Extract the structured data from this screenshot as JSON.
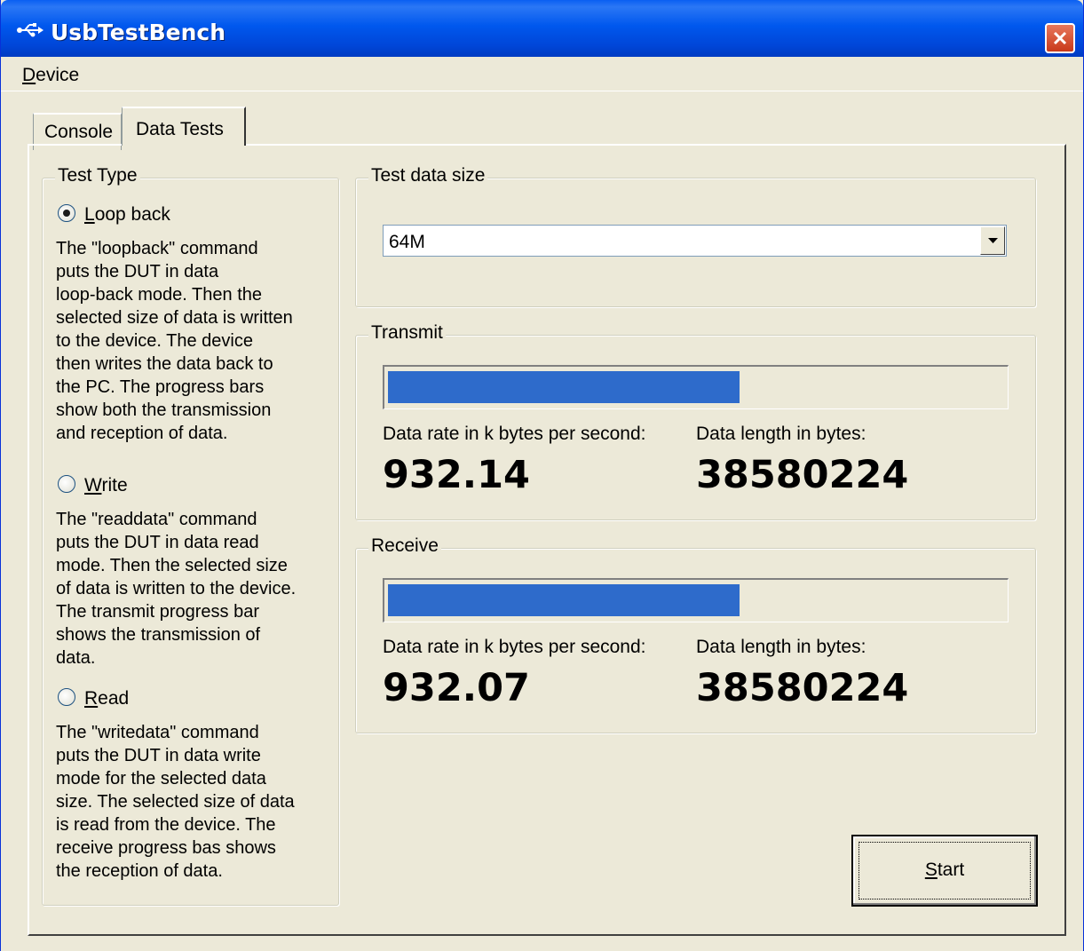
{
  "window": {
    "title": "UsbTestBench"
  },
  "menu": {
    "device_prefix": "D",
    "device_rest": "evice"
  },
  "tabs": [
    {
      "label": "Console"
    },
    {
      "label": "Data Tests"
    }
  ],
  "test_type": {
    "label": "Test Type",
    "options": [
      {
        "key_letter": "L",
        "label_rest": "oop back",
        "selected": true,
        "description_lines": [
          "The \"loopback\" command",
          "puts the DUT in data",
          "loop-back mode. Then the",
          "selected size of data is written",
          "to the device. The device",
          "then writes the data back to",
          "the PC. The progress bars",
          "show both the transmission",
          "and reception of data."
        ]
      },
      {
        "key_letter": "W",
        "label_rest": "rite",
        "selected": false,
        "description_lines": [
          "The \"readdata\" command",
          "puts the DUT in data read",
          "mode. Then the selected size",
          "of data is written to the device.",
          "The transmit progress bar",
          "shows the transmission of",
          "data."
        ]
      },
      {
        "key_letter": "R",
        "label_rest": "ead",
        "selected": false,
        "description_lines": [
          "The \"writedata\" command",
          "puts the DUT in data write",
          "mode for the selected data",
          "size. The selected size of data",
          "is read from the device. The",
          "receive progress bas shows",
          "the reception of data."
        ]
      }
    ]
  },
  "test_data_size": {
    "label": "Test data size",
    "value": "64M"
  },
  "transmit": {
    "label": "Transmit",
    "progress": 0.57,
    "rate_label": "Data rate in k bytes per second:",
    "rate_value": "932.14",
    "length_label": "Data length in bytes:",
    "length_value": "38580224"
  },
  "receive": {
    "label": "Receive",
    "progress": 0.57,
    "rate_label": "Data rate in k bytes per second:",
    "rate_value": "932.07",
    "length_label": "Data length in bytes:",
    "length_value": "38580224"
  },
  "start_button": {
    "key_letter": "S",
    "label_rest": "tart"
  },
  "colors": {
    "titlebar": "#0058ee",
    "progress_fill": "#2e6bcb",
    "close_button": "#c8391a"
  },
  "icons": {
    "title": "usb-icon",
    "close": "close-icon",
    "dropdown": "chevron-down-icon"
  }
}
